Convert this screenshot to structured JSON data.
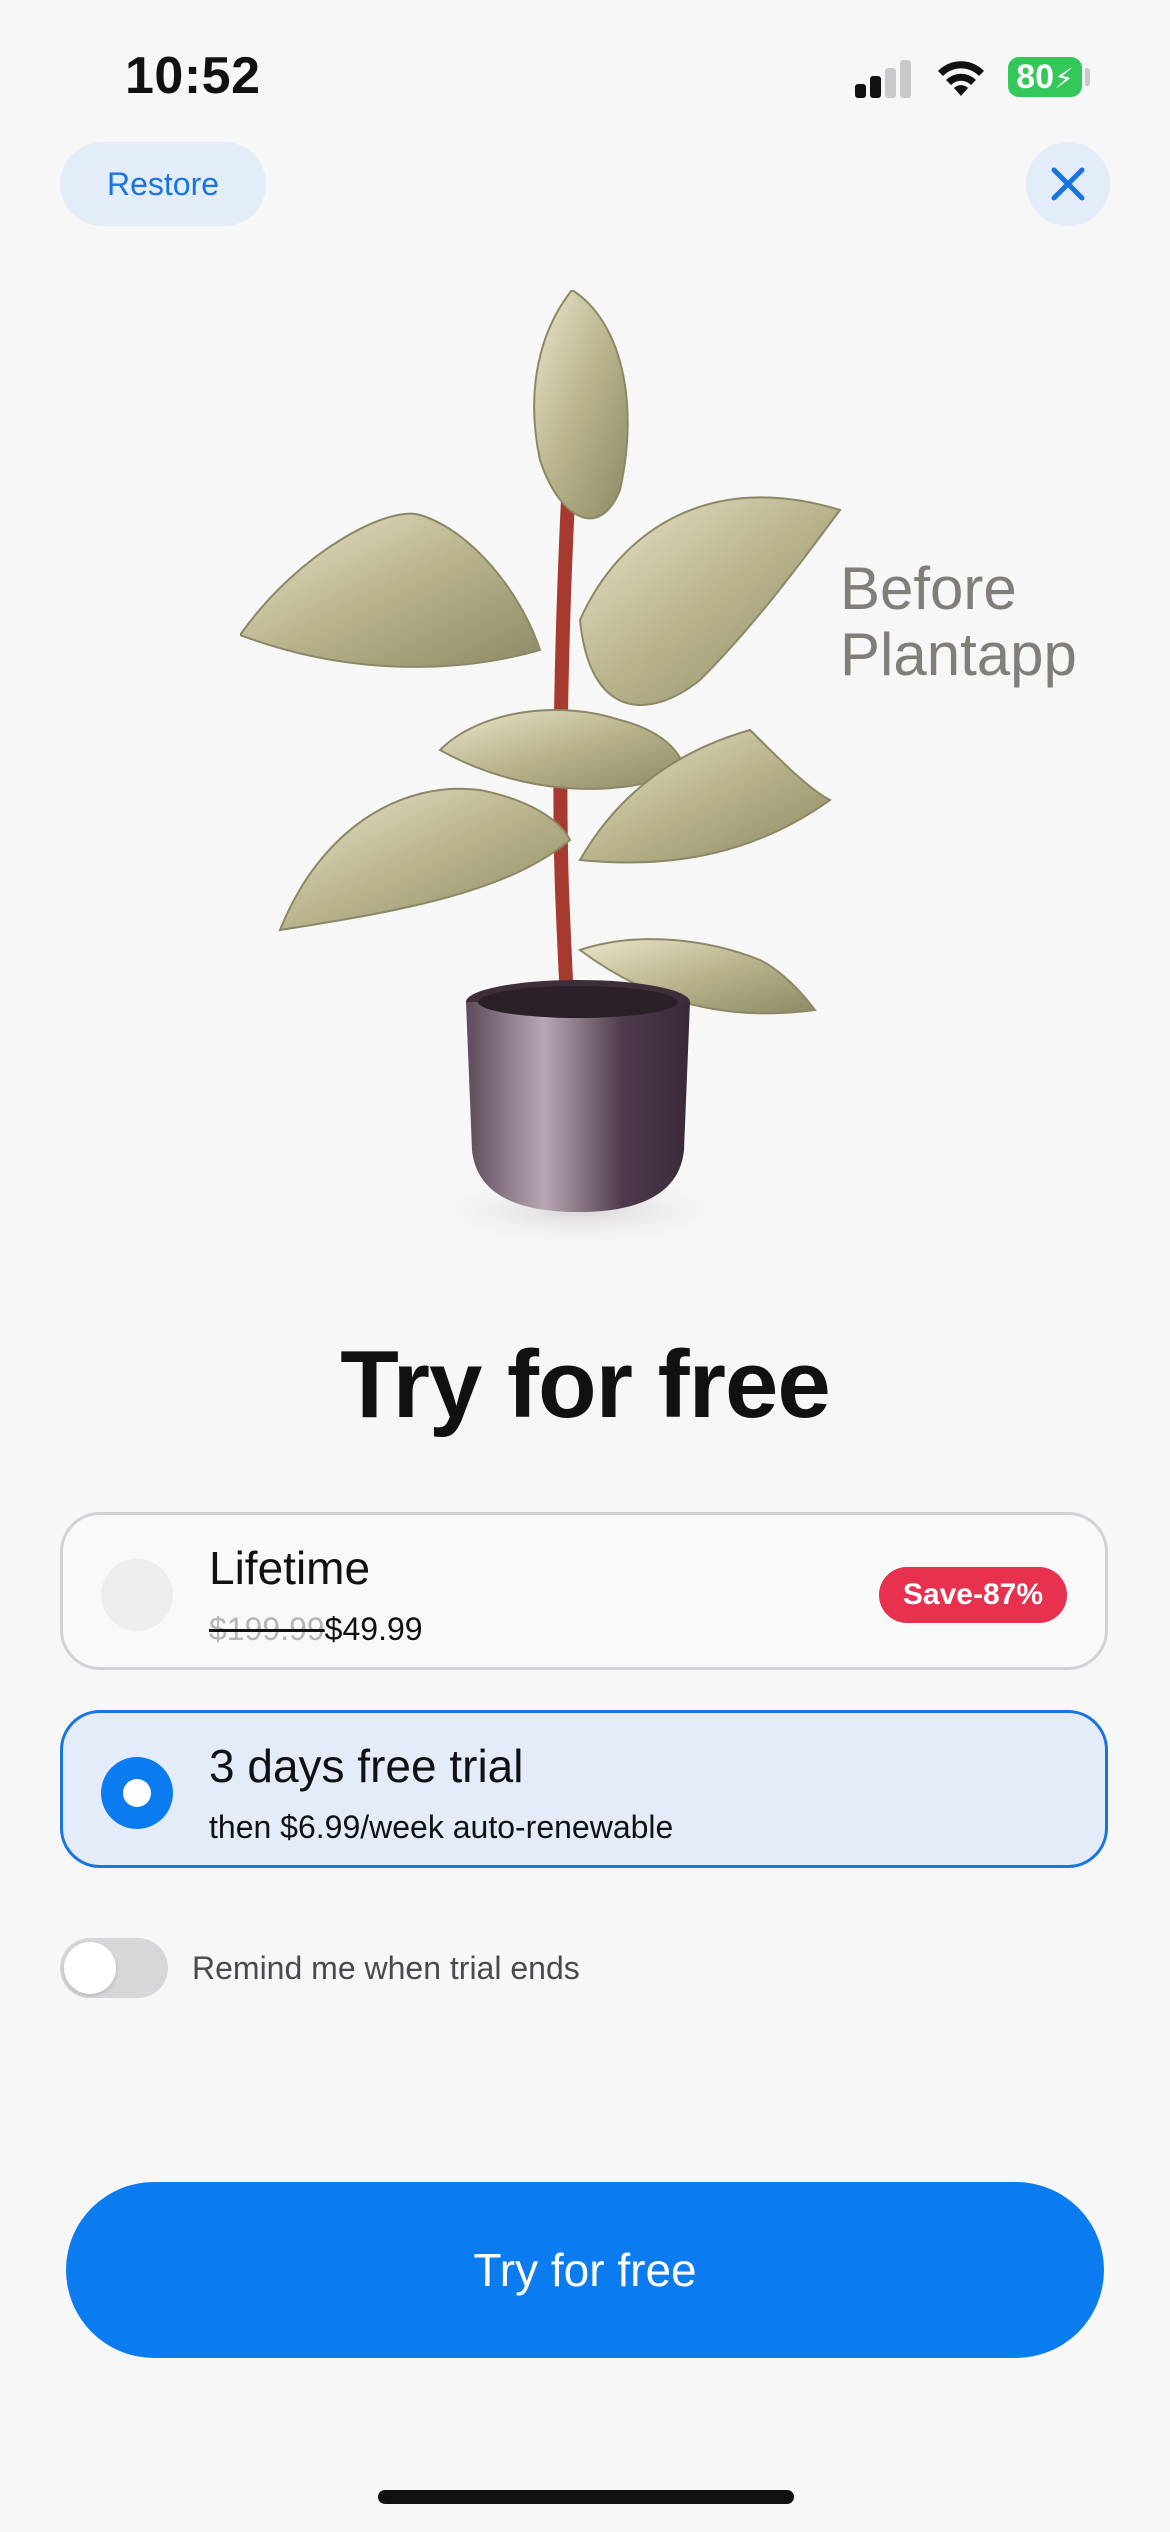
{
  "status_bar": {
    "time": "10:52",
    "battery": "80"
  },
  "top_bar": {
    "restore_label": "Restore",
    "close_icon": "close-icon"
  },
  "illustration": {
    "overlay_line1": "Before",
    "overlay_line2": "Plantapp"
  },
  "headline": "Try for free",
  "plans": [
    {
      "title": "Lifetime",
      "old_price": "$199.99",
      "price": "$49.99",
      "badge": "Save-87%",
      "selected": false
    },
    {
      "title": "3 days free trial",
      "subtitle": "then $6.99/week auto-renewable",
      "selected": true
    }
  ],
  "reminder": {
    "label": "Remind me when trial ends",
    "enabled": false
  },
  "cta_label": "Try for free",
  "colors": {
    "accent": "#0a7cf0",
    "badge": "#e8304f",
    "battery": "#34c759",
    "selected_card_bg": "#e5ecf9"
  }
}
